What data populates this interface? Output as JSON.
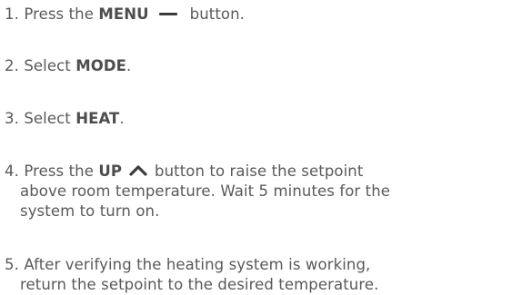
{
  "steps": [
    {
      "number": "1.",
      "before": "Press the",
      "bold": "MENU",
      "icon": "minus-dash-icon",
      "after": "button."
    },
    {
      "number": "2.",
      "before": "Select",
      "bold": "MODE",
      "after": "."
    },
    {
      "number": "3.",
      "before": "Select",
      "bold": "HEAT",
      "after": "."
    },
    {
      "number": "4.",
      "before": "Press the",
      "bold": "UP",
      "icon": "chevron-up-icon",
      "after": "button to raise the setpoint",
      "line2": "above room temperature. Wait 5 minutes for the",
      "line3": "system to turn on."
    },
    {
      "number": "5.",
      "line1": "After verifying the heating system is working,",
      "line2": "return the setpoint to the desired temperature."
    }
  ],
  "colors": {
    "text": "#58595b",
    "icon": "#3b3c3e"
  }
}
